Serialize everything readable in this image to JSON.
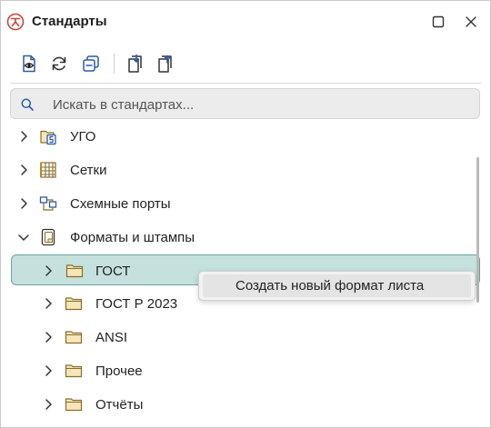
{
  "window": {
    "title": "Стандарты",
    "logo_icon": "app-logo-icon",
    "maximize_icon": "maximize-icon",
    "close_icon": "close-icon"
  },
  "toolbar": {
    "buttons": [
      {
        "name": "preview-standard-button",
        "icon": "document-eye-icon"
      },
      {
        "name": "refresh-button",
        "icon": "refresh-icon"
      },
      {
        "name": "collapse-all-button",
        "icon": "collapse-icon"
      },
      {
        "name": "import-button",
        "icon": "import-icon"
      },
      {
        "name": "export-button",
        "icon": "export-icon"
      }
    ]
  },
  "search": {
    "placeholder": "Искать в стандартах...",
    "value": ""
  },
  "tree": {
    "items": [
      {
        "label": "УГО",
        "icon": "ugo-icon",
        "expanded": false,
        "level": 0
      },
      {
        "label": "Сетки",
        "icon": "grid-icon",
        "expanded": false,
        "level": 0
      },
      {
        "label": "Схемные порты",
        "icon": "ports-icon",
        "expanded": false,
        "level": 0
      },
      {
        "label": "Форматы и штампы",
        "icon": "sheet-format-icon",
        "expanded": true,
        "level": 0
      },
      {
        "label": "ГОСТ",
        "icon": "folder-icon",
        "expanded": false,
        "level": 1,
        "selected": true
      },
      {
        "label": "ГОСТ Р 2023",
        "icon": "folder-icon",
        "expanded": false,
        "level": 1
      },
      {
        "label": "ANSI",
        "icon": "folder-icon",
        "expanded": false,
        "level": 1
      },
      {
        "label": "Прочее",
        "icon": "folder-icon",
        "expanded": false,
        "level": 1
      },
      {
        "label": "Отчёты",
        "icon": "folder-icon",
        "expanded": false,
        "level": 1
      }
    ]
  },
  "context_menu": {
    "items": [
      {
        "label": "Создать новый формат листа"
      }
    ]
  },
  "colors": {
    "selection_bg": "#c5e1dd",
    "selection_border": "#6aa49c",
    "accent_blue": "#2b5aa8",
    "logo_red": "#c8453c",
    "folder_fill": "#f6e6b8",
    "folder_stroke": "#8a6d2d"
  }
}
